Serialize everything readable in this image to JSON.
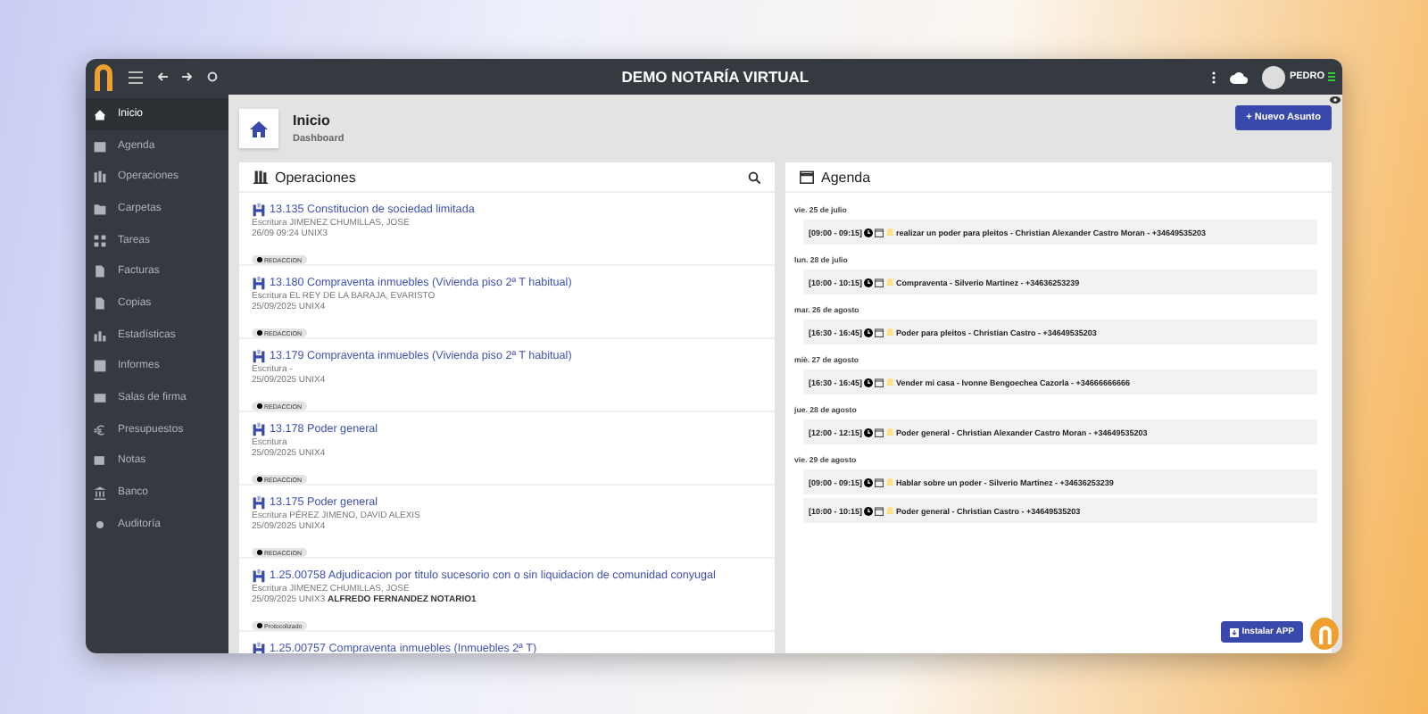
{
  "window": {
    "title": "DEMO NOTARÍA VIRTUAL",
    "user": "PEDRO"
  },
  "sidebar": {
    "items": [
      {
        "label": "Inicio",
        "selected": true
      },
      {
        "label": "Agenda",
        "selected": false
      },
      {
        "label": "Operaciones",
        "selected": false
      },
      {
        "label": "Carpetas",
        "selected": false
      },
      {
        "label": "Tareas",
        "selected": false
      },
      {
        "label": "Facturas",
        "selected": false
      },
      {
        "label": "Copias",
        "selected": false
      },
      {
        "label": "Estadísticas",
        "selected": false
      },
      {
        "label": "Informes",
        "selected": false
      },
      {
        "label": "Salas de firma",
        "selected": false
      },
      {
        "label": "Presupuestos",
        "selected": false
      },
      {
        "label": "Notas",
        "selected": false
      },
      {
        "label": "Banco",
        "selected": false
      },
      {
        "label": "Auditoría",
        "selected": false
      }
    ]
  },
  "header": {
    "title": "Inicio",
    "subtitle": "Dashboard",
    "button": "+ Nuevo Asunto"
  },
  "operaciones": {
    "title": "Operaciones",
    "items": [
      {
        "title": "13.135 Constitucion de sociedad limitada",
        "line_1": "Escritura JIMENEZ CHUMILLAS, JOSE",
        "line_2": "26/09 09:24 UNIX3",
        "status": "REDACCION"
      },
      {
        "title": "13.180 Compraventa inmuebles (Vivienda piso 2ª T habitual)",
        "line_1": "Escritura EL REY DE LA BARAJA, EVARISTO",
        "line_2": "25/09/2025 UNIX4",
        "status": "REDACCION"
      },
      {
        "title": "13.179 Compraventa inmuebles (Vivienda piso 2ª T habitual)",
        "line_1": "Escritura -",
        "line_2": "25/09/2025 UNIX4",
        "status": "REDACCION"
      },
      {
        "title": "13.178 Poder general",
        "line_1": "Escritura",
        "line_2": "25/09/2025 UNIX4",
        "status": "REDACCION"
      },
      {
        "title": "13.175 Poder general",
        "line_1": "Escritura PÉREZ JIMENO, DAVID ALEXIS",
        "line_2": "25/09/2025 UNIX4",
        "status": "REDACCION"
      },
      {
        "title": "1.25.00758 Adjudicacion por titulo sucesorio con o sin liquidacion de comunidad conyugal",
        "line_1": "Escritura JIMENEZ CHUMILLAS, JOSE",
        "line_2": "25/09/2025 UNIX3 **ALFREDO FERNANDEZ NOTARIO1**",
        "status": "Protocolizado"
      },
      {
        "title": "1.25.00757 Compraventa inmuebles (Inmuebles 2ª T)"
      }
    ]
  },
  "agenda": {
    "title": "Agenda",
    "days": [
      {
        "date": "vie. 25 de julio",
        "events": [
          {
            "time": "[09:00 - 09:15]",
            "description": "realizar un poder para pleitos - Christian Alexander Castro Moran - +34649535203"
          }
        ]
      },
      {
        "date": "lun. 28 de julio",
        "events": [
          {
            "time": "[10:00 - 10:15]",
            "description": "Compraventa - Silverio Martinez - +34636253239"
          }
        ]
      },
      {
        "date": "mar. 26 de agosto",
        "events": [
          {
            "time": "[16:30 - 16:45]",
            "description": "Poder para pleitos - Christian Castro - +34649535203"
          }
        ]
      },
      {
        "date": "miè. 27 de agosto",
        "events": [
          {
            "time": "[16:30 - 16:45]",
            "description": "Vender mi casa - Ivonne Bengoechea Cazorla - +34666666666"
          }
        ]
      },
      {
        "date": "jue. 28 de agosto",
        "events": [
          {
            "time": "[12:00 - 12:15]",
            "description": "Poder general - Christian Alexander Castro Moran - +34649535203"
          }
        ]
      },
      {
        "date": "vie. 29 de agosto",
        "events": [
          {
            "time": "[09:00 - 09:15]",
            "description": "Hablar sobre un poder - Silverio Martinez - +34636253239"
          },
          {
            "time": "[10:00 - 10:15]",
            "description": "Poder general - Christian Castro - +34649535203"
          }
        ]
      }
    ]
  },
  "install_button": "Instalar APP"
}
